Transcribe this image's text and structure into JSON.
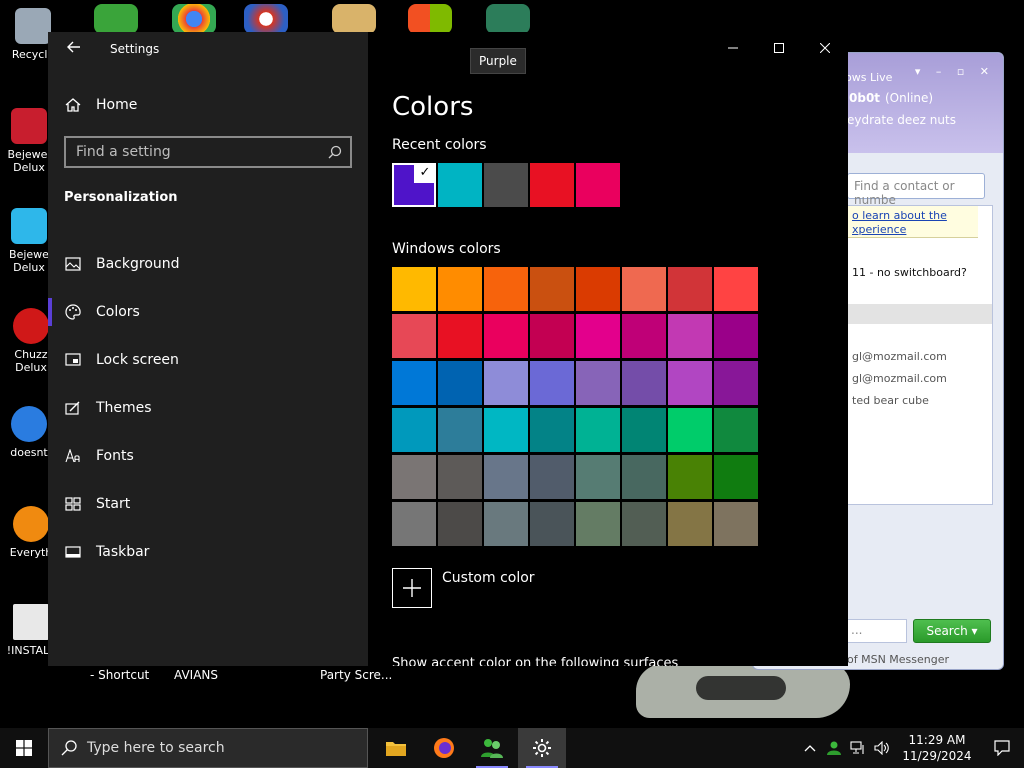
{
  "desktop": {
    "icons": [
      {
        "label": "Recycle",
        "color": "#9aa8b6"
      },
      {
        "label": "Bejewel",
        "label2": "Delux",
        "color": "#c81e2e"
      },
      {
        "label": "Bejewe",
        "label2": "Delux",
        "color": "#2eb7ea"
      },
      {
        "label": "Chuzz",
        "label2": "Delux",
        "color": "#d01818"
      },
      {
        "label": "doesnt",
        "color": "#2a7ce0"
      },
      {
        "label": "Everyth",
        "color": "#f08a10"
      },
      {
        "label": "!INSTALL",
        "color": "#e8e8e8"
      }
    ],
    "below_labels": [
      "- Shortcut",
      "AVIANS",
      "Party Scre..."
    ]
  },
  "msn": {
    "title": "ows Live",
    "user": "0b0t",
    "status": "(Online)",
    "personal_message": "eydrate deez nuts",
    "find_placeholder": "Find a contact or numbe",
    "note_line1": "o learn about the",
    "note_line2": "xperience",
    "rows": [
      "11 - no switchboard?",
      "gl@mozmail.com",
      "gl@mozmail.com",
      "ted bear cube"
    ],
    "search_label": "Search",
    "search_placeholder": "...",
    "footer": "of MSN Messenger"
  },
  "settings": {
    "window_title": "Settings",
    "home_label": "Home",
    "find_placeholder": "Find a setting",
    "section_label": "Personalization",
    "nav": [
      {
        "label": "Background",
        "icon": "image-icon"
      },
      {
        "label": "Colors",
        "icon": "palette-icon",
        "active": true
      },
      {
        "label": "Lock screen",
        "icon": "lock-screen-icon"
      },
      {
        "label": "Themes",
        "icon": "themes-icon"
      },
      {
        "label": "Fonts",
        "icon": "fonts-icon"
      },
      {
        "label": "Start",
        "icon": "start-icon"
      },
      {
        "label": "Taskbar",
        "icon": "taskbar-icon"
      }
    ],
    "tooltip": "Purple",
    "page_title": "Colors",
    "recent_colors_label": "Recent colors",
    "recent_colors": [
      "#4f14c9",
      "#00b4c3",
      "#4b4b4b",
      "#e81123",
      "#ea005e"
    ],
    "windows_colors_label": "Windows colors",
    "windows_colors": [
      [
        "#ffb900",
        "#ff8c00",
        "#f7630c",
        "#ca5010",
        "#da3b01",
        "#ef6950",
        "#d13438",
        "#ff4343"
      ],
      [
        "#e74856",
        "#e81123",
        "#ea005e",
        "#c30052",
        "#e3008c",
        "#bf0077",
        "#c239b3",
        "#9a0089"
      ],
      [
        "#0078d7",
        "#0063b1",
        "#8e8cd8",
        "#6b69d6",
        "#8764b8",
        "#744da9",
        "#b146c2",
        "#881798"
      ],
      [
        "#0099bc",
        "#2d7d9a",
        "#00b7c3",
        "#038387",
        "#00b294",
        "#018574",
        "#00cc6a",
        "#10893e"
      ],
      [
        "#7a7574",
        "#5d5a58",
        "#68768a",
        "#515c6b",
        "#567c73",
        "#486860",
        "#498205",
        "#107c10"
      ],
      [
        "#767676",
        "#4c4a48",
        "#69797e",
        "#4a5459",
        "#647c64",
        "#525e54",
        "#847545",
        "#7e735f"
      ]
    ],
    "custom_color_label": "Custom color",
    "cutoff_text": "Show accent color on the following surfaces"
  },
  "taskbar": {
    "search_placeholder": "Type here to search",
    "time": "11:29 AM",
    "date": "11/29/2024"
  }
}
